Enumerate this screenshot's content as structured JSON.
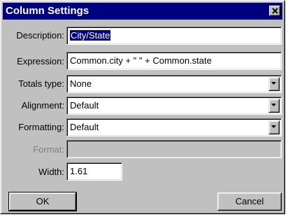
{
  "dialog": {
    "title": "Column Settings",
    "close_glyph": "close-icon"
  },
  "fields": {
    "description": {
      "label": "Description:",
      "value": "City/State"
    },
    "expression": {
      "label": "Expression:",
      "value": "Common.city + \" \" + Common.state"
    },
    "totals_type": {
      "label": "Totals type:",
      "value": "None"
    },
    "alignment": {
      "label": "Alignment:",
      "value": "Default"
    },
    "formatting": {
      "label": "Formatting:",
      "value": "Default"
    },
    "format": {
      "label": "Format:",
      "value": ""
    },
    "width": {
      "label": "Width:",
      "value": "1.61"
    }
  },
  "buttons": {
    "ok": "OK",
    "cancel": "Cancel"
  },
  "colors": {
    "titlebar": "#000080",
    "face": "#c0c0c0",
    "selection": "#000080",
    "disabled_text": "#808080"
  }
}
